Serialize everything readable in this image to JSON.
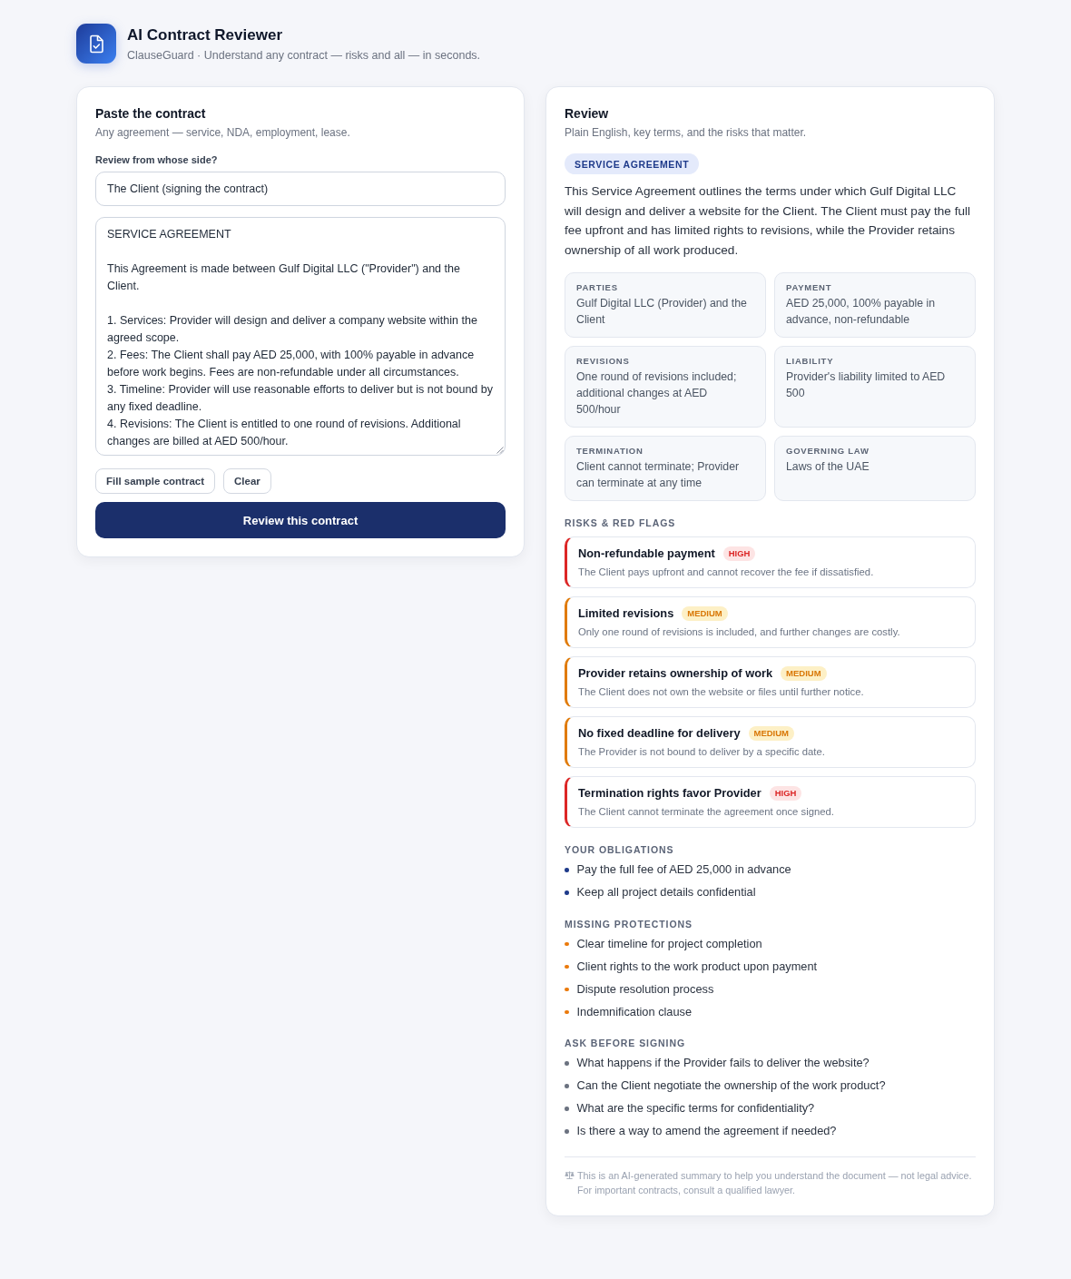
{
  "header": {
    "title": "AI Contract Reviewer",
    "subtitle": "ClauseGuard · Understand any contract — risks and all — in seconds."
  },
  "input_panel": {
    "title": "Paste the contract",
    "subtitle": "Any agreement — service, NDA, employment, lease.",
    "side_label": "Review from whose side?",
    "side_value": "The Client (signing the contract)",
    "contract_text": "SERVICE AGREEMENT\n\nThis Agreement is made between Gulf Digital LLC (\"Provider\") and the Client.\n\n1. Services: Provider will design and deliver a company website within the agreed scope.\n2. Fees: The Client shall pay AED 25,000, with 100% payable in advance before work begins. Fees are non-refundable under all circumstances.\n3. Timeline: Provider will use reasonable efforts to deliver but is not bound by any fixed deadline.\n4. Revisions: The Client is entitled to one round of revisions. Additional changes are billed at AED 500/hour.",
    "actions": [
      "Fill sample contract",
      "Clear"
    ],
    "submit_button": "Review this contract"
  },
  "review_panel": {
    "title": "Review",
    "subtitle": "Plain English, key terms, and the risks that matter.",
    "document_type": "SERVICE AGREEMENT",
    "summary": "This Service Agreement outlines the terms under which Gulf Digital LLC will design and deliver a website for the Client. The Client must pay the full fee upfront and has limited rights to revisions, while the Provider retains ownership of all work produced.",
    "key_terms": [
      {
        "label": "PARTIES",
        "value": "Gulf Digital LLC (Provider) and the Client"
      },
      {
        "label": "PAYMENT",
        "value": "AED 25,000, 100% payable in advance, non-refundable"
      },
      {
        "label": "REVISIONS",
        "value": "One round of revisions included; additional changes at AED 500/hour"
      },
      {
        "label": "LIABILITY",
        "value": "Provider's liability limited to AED 500"
      },
      {
        "label": "TERMINATION",
        "value": "Client cannot terminate; Provider can terminate at any time"
      },
      {
        "label": "GOVERNING LAW",
        "value": "Laws of the UAE"
      }
    ],
    "risks_heading": "RISKS & RED FLAGS",
    "risks": [
      {
        "title": "Non-refundable payment",
        "kind": "high",
        "badge": "HIGH",
        "description": "The Client pays upfront and cannot recover the fee if dissatisfied."
      },
      {
        "title": "Limited revisions",
        "kind": "medium",
        "badge": "MEDIUM",
        "description": "Only one round of revisions is included, and further changes are costly."
      },
      {
        "title": "Provider retains ownership of work",
        "kind": "medium",
        "badge": "MEDIUM",
        "description": "The Client does not own the website or files until further notice."
      },
      {
        "title": "No fixed deadline for delivery",
        "kind": "medium",
        "badge": "MEDIUM",
        "description": "The Provider is not bound to deliver by a specific date."
      },
      {
        "title": "Termination rights favor Provider",
        "kind": "high",
        "badge": "HIGH",
        "description": "The Client cannot terminate the agreement once signed."
      }
    ],
    "lists": [
      {
        "heading": "YOUR OBLIGATIONS",
        "kind": "obligation",
        "items": [
          "Pay the full fee of AED 25,000 in advance",
          "Keep all project details confidential"
        ]
      },
      {
        "heading": "MISSING PROTECTIONS",
        "kind": "missing",
        "items": [
          "Clear timeline for project completion",
          "Client rights to the work product upon payment",
          "Dispute resolution process",
          "Indemnification clause"
        ]
      },
      {
        "heading": "ASK BEFORE SIGNING",
        "kind": "question",
        "items": [
          "What happens if the Provider fails to deliver the website?",
          "Can the Client negotiate the ownership of the work product?",
          "What are the specific terms for confidentiality?",
          "Is there a way to amend the agreement if needed?"
        ]
      }
    ],
    "disclaimer": "This is an AI-generated summary to help you understand the document — not legal advice. For important contracts, consult a qualified lawyer."
  }
}
